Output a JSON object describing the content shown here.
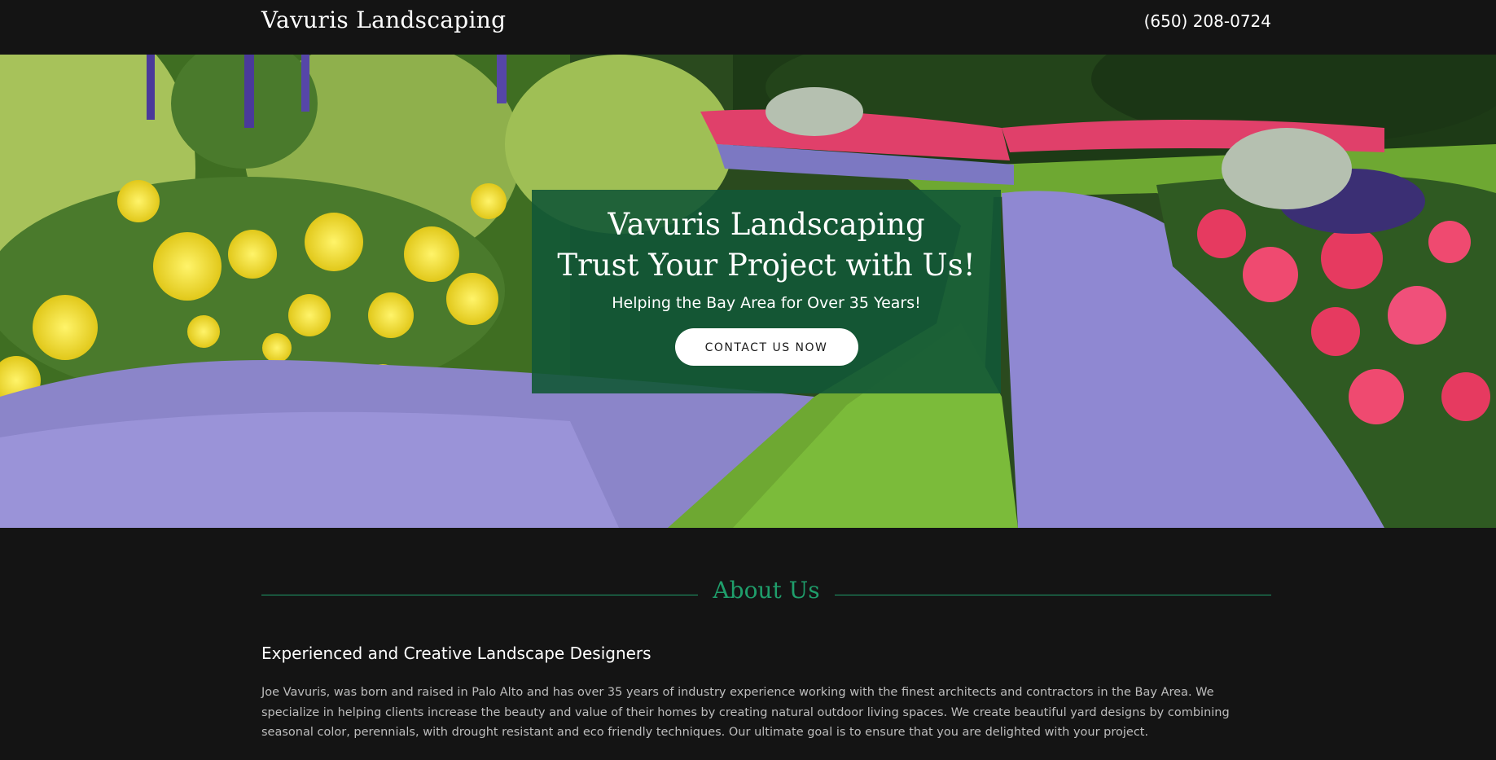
{
  "header": {
    "site_title": "Vavuris Landscaping",
    "phone": "(650) 208-0724"
  },
  "hero": {
    "title_line1": "Vavuris Landscaping",
    "title_line2": "Trust Your Project with Us!",
    "subtitle": "Helping the Bay Area for Over 35 Years!",
    "cta_label": "CONTACT US NOW",
    "background_image": "garden-flower-beds-photo"
  },
  "about": {
    "heading": "About Us",
    "subheading": "Experienced and Creative Landscape Designers",
    "body": "Joe Vavuris, was born and raised in Palo Alto and has over 35 years of industry experience working with the finest architects and contractors in the Bay Area. We specialize in helping clients increase the beauty and value of their homes by creating natural outdoor living spaces. We create beautiful yard designs by combining seasonal color, perennials, with drought resistant and eco friendly techniques. Our ultimate goal is to ensure that you are delighted with your project."
  },
  "colors": {
    "page_background": "#141414",
    "accent_green": "#1f9e6b",
    "hero_box": "#125836"
  }
}
